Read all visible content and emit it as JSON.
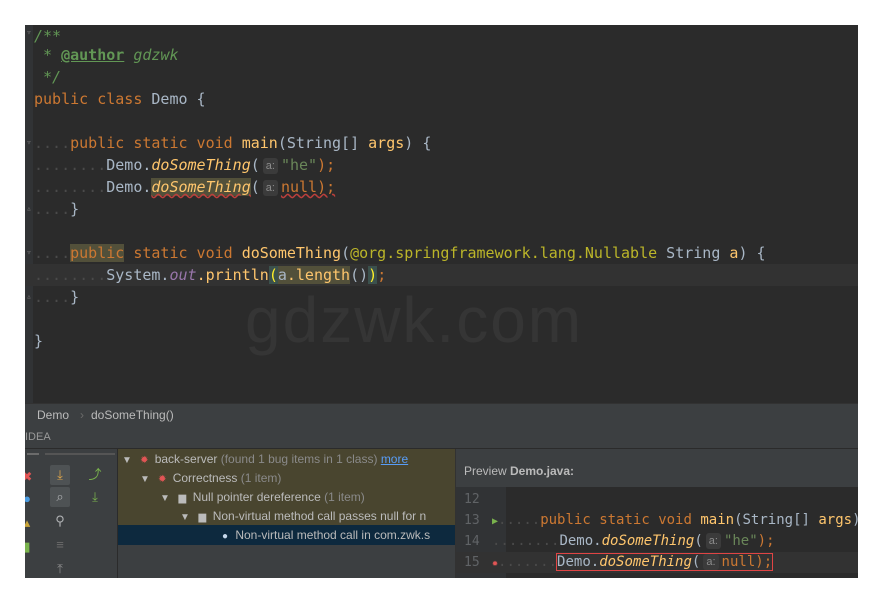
{
  "editor": {
    "lines": {
      "l1_prefix": "/**",
      "l2_star": "* ",
      "l2_tag": "@author",
      "l2_name": " gdzwk",
      "l3": "*/",
      "l4_kw": "public class ",
      "l4_name": "Demo {",
      "l6_kw1": "public static void ",
      "l6_method": "main",
      "l6_rest": "(String[] ",
      "l6_args": "args",
      "l6_end": ") {",
      "l7_cls": "Demo.",
      "l7_method": "doSomeThing",
      "l7_paren": "(",
      "l7_hint": "a:",
      "l7_str": "\"he\"",
      "l7_end": ");",
      "l8_cls": "Demo.",
      "l8_method": "doSomeThing",
      "l8_paren": "(",
      "l8_hint": "a:",
      "l8_null": "null",
      "l8_end": ");",
      "l9": "}",
      "l11_kw1": "public",
      "l11_kw2": " static void ",
      "l11_method": "doSomeThing",
      "l11_paren": "(",
      "l11_ann": "@org.springframework.lang.",
      "l11_ann2": "Nullable",
      "l11_type": " String ",
      "l11_param": "a",
      "l11_end": ") {",
      "l12_sys": "System.",
      "l12_out": "out",
      "l12_call": ".println",
      "l12_open": "(",
      "l12_a": "a",
      "l12_len": ".length",
      "l12_rest": "()",
      "l12_close": ")",
      "l12_semi": ";",
      "l13": "}",
      "l15": "}"
    },
    "watermark": "gdzwk.com"
  },
  "breadcrumb": {
    "item1": "Demo",
    "sep": "›",
    "item2": "doSomeThing()"
  },
  "toolwindow": {
    "title": "IDEA",
    "tree": {
      "root_name": "back-server",
      "root_info": "(found 1 bug items in 1 class)",
      "root_more": "more",
      "cat_name": "Correctness",
      "cat_count": "(1 item)",
      "type_name": "Null pointer dereference",
      "type_count": "(1 item)",
      "pattern_name": "Non-virtual method call passes null for n",
      "item_name": "Non-virtual method call in com.zwk.s"
    },
    "preview": {
      "label": "Preview",
      "file": "Demo.java:",
      "lines": [
        {
          "num": "12"
        },
        {
          "num": "13",
          "kw": "public static void ",
          "method": "main",
          "rest": "(String[] ",
          "args": "args",
          "end": ") {"
        },
        {
          "num": "14",
          "cls": "Demo.",
          "method": "doSomeThing",
          "paren": "(",
          "hint": "a:",
          "str": "\"he\"",
          "end": ");"
        },
        {
          "num": "15",
          "cls": "Demo.",
          "method": "doSomeThing",
          "paren": "(",
          "hint": "a:",
          "null": "null",
          "end": ");"
        }
      ]
    }
  },
  "colors": {
    "editor_bg": "#2b2b2b",
    "keyword": "#cc7832",
    "method": "#ffc66d",
    "string": "#6a8759",
    "annotation": "#bbb529",
    "static_field": "#9876aa",
    "selection_highlight": "#0d293e",
    "warning_highlight": "#52503a"
  }
}
